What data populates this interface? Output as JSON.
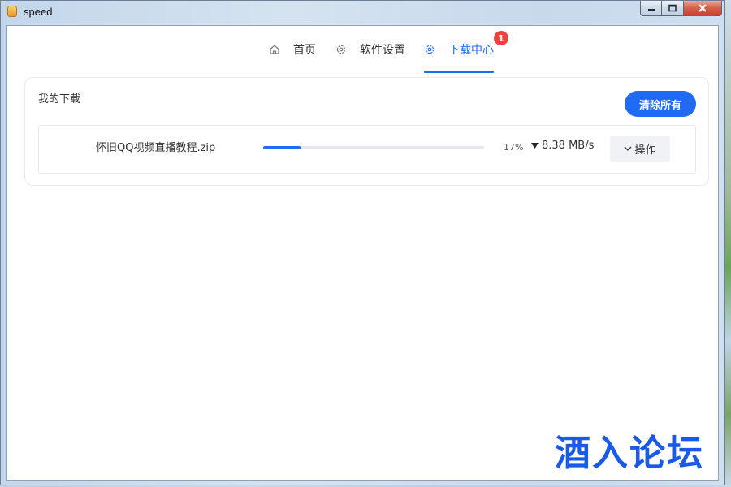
{
  "window": {
    "title": "speed"
  },
  "nav": {
    "items": [
      {
        "label": "首页",
        "icon": "home-icon"
      },
      {
        "label": "软件设置",
        "icon": "gear-icon"
      },
      {
        "label": "下载中心",
        "icon": "gear-icon",
        "active": true,
        "badge": "1"
      }
    ]
  },
  "downloads": {
    "title": "我的下载",
    "clear_all_label": "清除所有",
    "items": [
      {
        "file_name": "怀旧QQ视频直播教程.zip",
        "progress_percent": 17,
        "percent_text": "17%",
        "speed": "8.38 MB/s",
        "action_label": "操作"
      }
    ]
  },
  "watermark": "酒入论坛",
  "colors": {
    "accent": "#1f6bf5",
    "badge": "#f0413d",
    "watermark": "#1a5ae8"
  }
}
